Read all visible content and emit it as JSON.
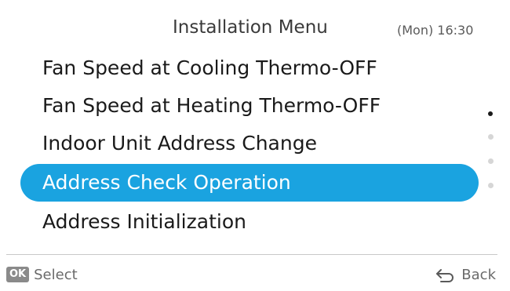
{
  "header": {
    "title": "Installation Menu",
    "clock": "(Mon) 16:30"
  },
  "menu": {
    "items": [
      {
        "label": "Fan Speed at Cooling Thermo-OFF",
        "selected": false
      },
      {
        "label": "Fan Speed at Heating Thermo-OFF",
        "selected": false
      },
      {
        "label": "Indoor Unit Address Change",
        "selected": false
      },
      {
        "label": "Address Check Operation",
        "selected": true
      },
      {
        "label": "Address Initialization",
        "selected": false
      }
    ],
    "page_count": 4,
    "current_page": 1
  },
  "footer": {
    "ok_badge": "OK",
    "select_label": "Select",
    "back_label": "Back",
    "back_icon": "return-arrow-icon"
  },
  "colors": {
    "selection": "#1aa3e0",
    "text": "#1a1a1a",
    "muted": "#6a6a6a"
  }
}
